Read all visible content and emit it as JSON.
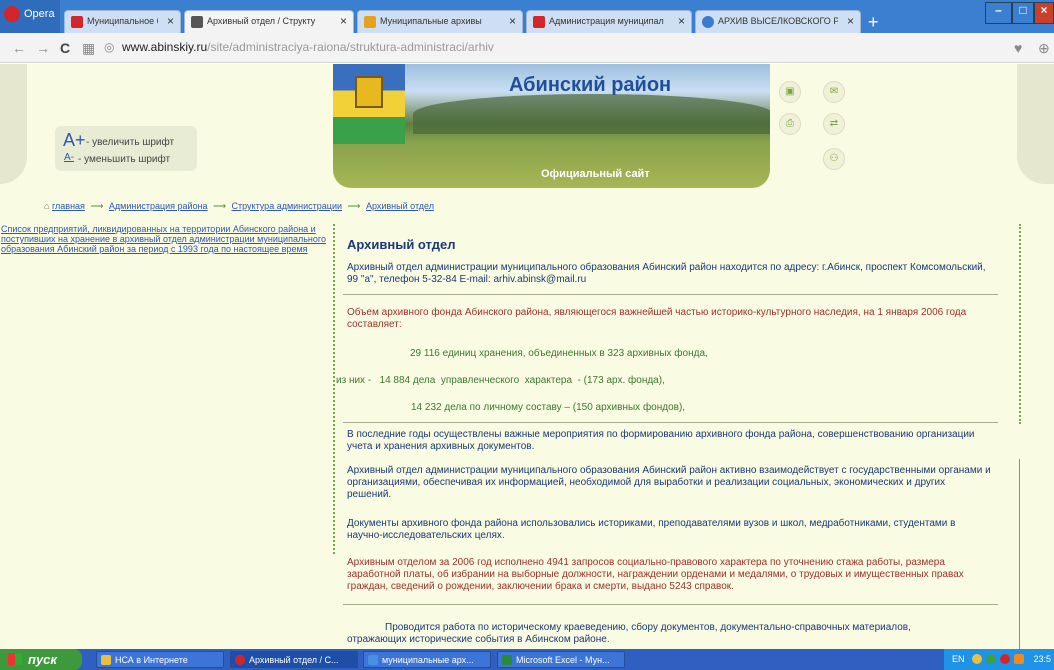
{
  "browser": {
    "opera_label": "Opera",
    "tabs": [
      {
        "title": "Муниципальное бюджетн",
        "active": false,
        "favicon_color": "#d3262b"
      },
      {
        "title": "Архивный отдел / Структу",
        "active": true,
        "favicon_color": "#555555"
      },
      {
        "title": "Муниципальные архивы",
        "active": false,
        "favicon_color": "#e8a020"
      },
      {
        "title": "Администрация муниципал",
        "active": false,
        "favicon_color": "#d3262b"
      },
      {
        "title": "АРХИВ ВЫСЕЛКОВСКОГО Р",
        "active": false,
        "favicon_color": "#3a7ad0"
      }
    ],
    "new_tab": "+",
    "address": {
      "domain": "www.abinskiy.ru",
      "path": "/site/administraciya-raiona/struktura-administraci/arhiv"
    }
  },
  "site": {
    "font_controls": {
      "increase_symbol": "A+",
      "increase_label": "- увеличить шрифт",
      "decrease_symbol": "A-",
      "decrease_label": "- уменьшить шрифт"
    },
    "banner_title": "Абинский район",
    "banner_subtitle": "Официальный сайт"
  },
  "breadcrumb": {
    "items": [
      "главная",
      "Администрация района",
      "Структура администрации",
      "Архивный отдел"
    ]
  },
  "sidebar": {
    "link": "Список предприятий, ликвидированных на территории Абинского района и поступивших на хранение в архивный отдел администрации муниципального образования Абинский район за период с 1993 года по настоящее время"
  },
  "content": {
    "heading": "Архивный отдел",
    "address_text": "Архивный отдел администрации муниципального образования Абинский район находится по адресу: г.Абинск, проспект Комсомольский, 99 \"а\", телефон 5-32-84 E-mail: arhiv.abinsk@mail.ru",
    "fund_intro": "Объем архивного фонда Абинского района, являющегося важнейшей частью историко-культурного наследия, на 1 января 2006 года составляет:",
    "fund_line1": "29 116   единиц хранения, объединенных в 323 архивных фонда,",
    "fund_line2": "из них -   14 884 дела  управленческого  характера  - (173 арх. фонда),",
    "fund_line3": "14 232 дела  по личному составу – (150 архивных фондов),",
    "para1": "В последние годы осуществлены важные мероприятия по формированию архивного фонда района, совершенствованию организации учета и хранения архивных документов.",
    "para2": "Архивный отдел администрации муниципального образования Абинский район активно взаимодействует с государственными органами и организациями, обеспечивая их информацией, необходимой для выработки и реализации социальных, экономических и других решений.",
    "para3": "Документы архивного фонда района использовались историками, преподавателями вузов и школ, медработниками, студентами в научно-исследовательских целях.",
    "para4": "Архивным отделом за 2006 год исполнено 4941 запросов социально-правового характера по уточнению стажа работы, размера заработной платы, об избрании на выборные должности, награждении орденами и медалями, о трудовых и имущественных правах граждан, сведений о рождении, заключении брака и смерти, выдано 5243 справок.",
    "para5": "Проводится работа по историческому краеведению, сбору документов, документально-справочных материалов, отражающих исторические события в Абинском районе."
  },
  "taskbar": {
    "start_label": "пуск",
    "items": [
      {
        "label": "НСА в Интернете",
        "color": "#e8c040"
      },
      {
        "label": "Архивный отдел / С...",
        "color": "#d3262b"
      },
      {
        "label": "муниципальные арх...",
        "color": "#4a90e2"
      },
      {
        "label": "Microsoft Excel - Мун...",
        "color": "#2a8a3a"
      }
    ],
    "language": "EN",
    "clock": "23:5"
  },
  "colors": {
    "page_bg": "#f9fbe3",
    "link": "#2f57b5",
    "heading": "#1b3a75",
    "accent_green": "#7ea447",
    "red_text": "#a0322d"
  }
}
